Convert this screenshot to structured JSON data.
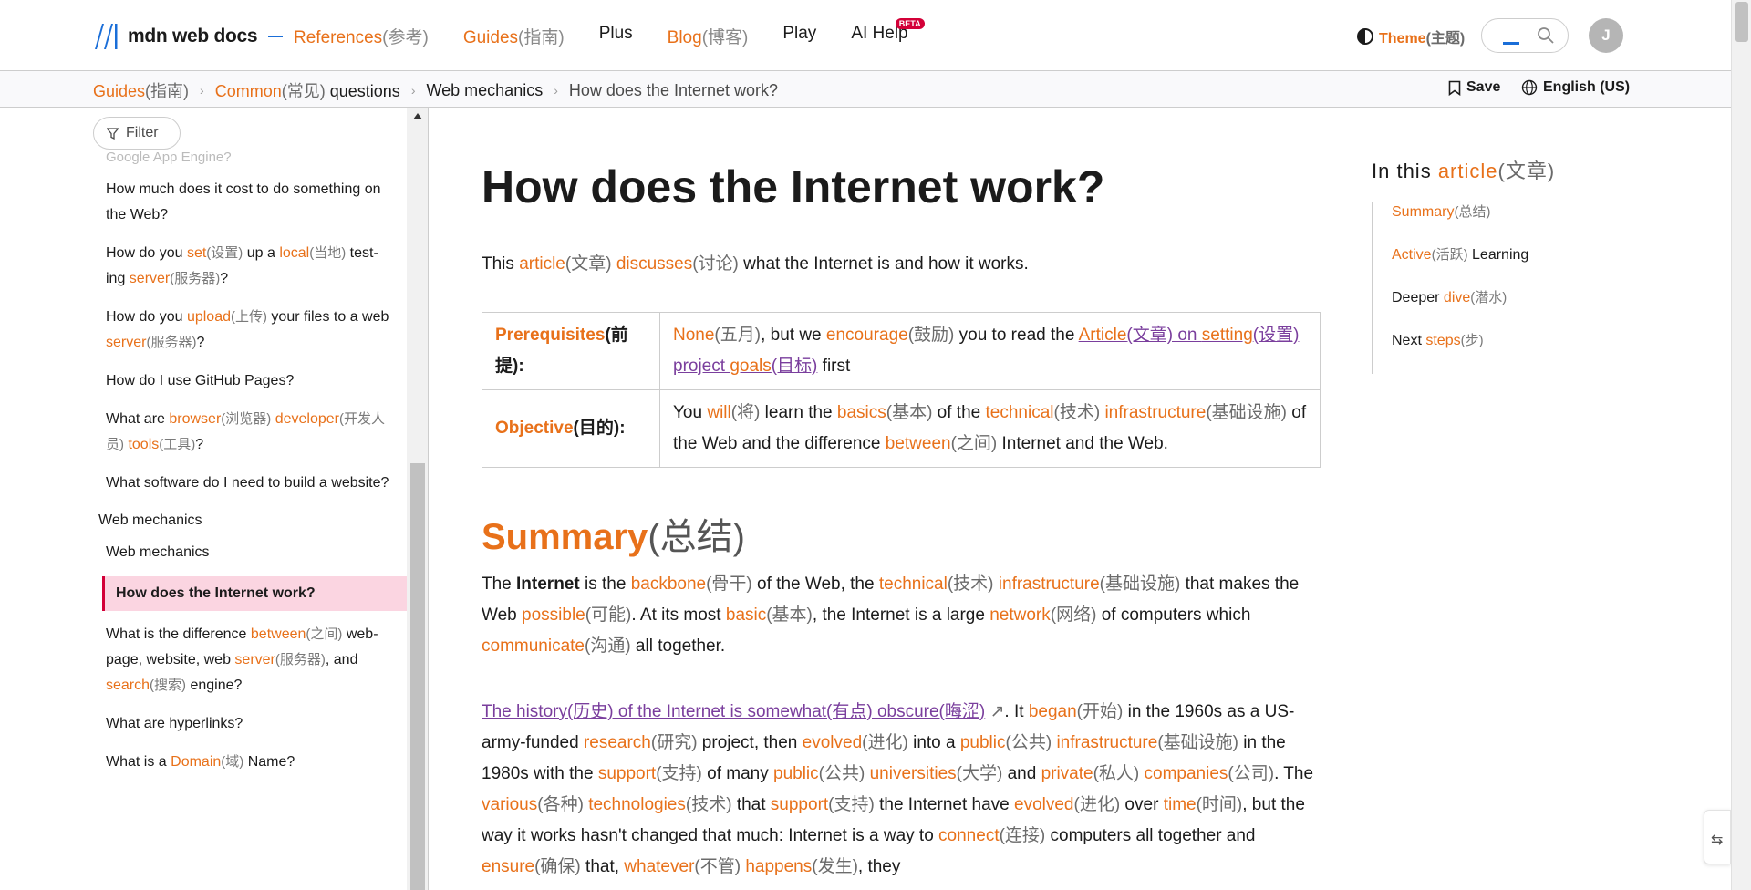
{
  "header": {
    "logo_text": "mdn web docs",
    "nav": [
      {
        "en": "References",
        "cn": "(参考)",
        "highlight": true
      },
      {
        "en": "Guides",
        "cn": "(指南)",
        "highlight": true
      },
      {
        "en": "Plus",
        "cn": "",
        "highlight": false
      },
      {
        "en": "Blog",
        "cn": "(博客)",
        "highlight": true
      },
      {
        "en": "Play",
        "cn": "",
        "highlight": false
      },
      {
        "en": "AI Help",
        "cn": "",
        "highlight": false,
        "badge": "BETA"
      }
    ],
    "theme_en": "Theme",
    "theme_cn": "(主题)",
    "avatar_letter": "J"
  },
  "breadcrumb": {
    "guides_en": "Guides",
    "guides_cn": "(指南)",
    "common_en": "Common",
    "common_cn": "(常见)",
    "common_rest": " questions",
    "web_mechanics": "Web mechanics",
    "current": "How does the Internet work?",
    "save_label": "Save",
    "language_label": "English (US)"
  },
  "sidebar": {
    "filter_label": "Filter",
    "faded_item": "Google App Engine?",
    "items_before": [
      {
        "html": "How much does it cost to do something on the Web?"
      },
      {
        "html": "How do you <span class=\"o\">set</span><span class=\"cn\">(设置)</span> up a <span class=\"o\">local</span><span class=\"cn\">(当地)</span> test-ing <span class=\"o\">server</span><span class=\"cn\">(服务器)</span>?"
      },
      {
        "html": "How do you <span class=\"o\">upload</span><span class=\"cn\">(上传)</span> your files to a web <span class=\"o\">server</span><span class=\"cn\">(服务器)</span>?"
      },
      {
        "html": "How do I use GitHub Pages?"
      },
      {
        "html": "What are <span class=\"o\">browser</span><span class=\"cn\">(浏览器)</span> <span class=\"o\">developer</span><span class=\"cn\">(开发人员)</span> <span class=\"o\">tools</span><span class=\"cn\">(工具)</span>?"
      },
      {
        "html": "What software do I need to build a website?"
      }
    ],
    "group_label": "Web mechanics",
    "group_first": "Web mechanics",
    "active_item": "How does the Internet work?",
    "items_after": [
      {
        "html": "What is the difference <span class=\"o\">between</span><span class=\"cn\">(之间)</span> web-page, website, web <span class=\"o\">server</span><span class=\"cn\">(服务器)</span>, and <span class=\"o\">search</span><span class=\"cn\">(搜索)</span> engine?"
      },
      {
        "html": "What are hyperlinks?"
      },
      {
        "html": "What is a <span class=\"o\">Domain</span><span class=\"cn\">(域)</span> Name?"
      }
    ]
  },
  "article": {
    "title": "How does the Internet work?",
    "intro_html": "This <span class=\"o\">article</span><span class=\"g\">(文章)</span> <span class=\"o\">discusses</span><span class=\"g\">(讨论)</span> what the Internet is and how it works.",
    "prereq_label_en": "Prerequisites",
    "prereq_label_cn": "(前提):",
    "prereq_html": "<span class=\"o\">None</span><span class=\"g\">(五月)</span>, but we <span class=\"o\">encourage</span><span class=\"g\">(鼓励)</span> you to read the <a class=\"lnk\" data-name=\"article-link\" data-interactable=\"true\"><span class=\"o\">Article</span>(文章) on <span class=\"o\">setting</span>(设置) project <span class=\"o\">goals</span>(目标)</a> first",
    "objective_label_en": "Objective",
    "objective_label_cn": "(目的):",
    "objective_html": "You <span class=\"o\">will</span><span class=\"g\">(将)</span> learn the <span class=\"o\">basics</span><span class=\"g\">(基本)</span> of the <span class=\"o\">technical</span><span class=\"g\">(技术)</span> <span class=\"o\">infrastructure</span><span class=\"g\">(基础设施)</span> of the Web and the difference <span class=\"o\">between</span><span class=\"g\">(之间)</span> Internet and the Web.",
    "summary_en": "Summary",
    "summary_cn": "(总结)",
    "p1_html": "The <b>Internet</b> is the <span class=\"o\">backbone</span><span class=\"g\">(骨干)</span> of the Web, the <span class=\"o\">technical</span><span class=\"g\">(技术)</span> <span class=\"o\">infrastructure</span><span class=\"g\">(基础设施)</span> that makes the Web <span class=\"o\">possible</span><span class=\"g\">(可能)</span>. At its most <span class=\"o\">basic</span><span class=\"g\">(基本)</span>, the Internet is a large <span class=\"o\">network</span><span class=\"g\">(网络)</span> of computers which <span class=\"o\">communicate</span><span class=\"g\">(沟通)</span> all together.",
    "p2_html": "<a class=\"hist\" data-name=\"history-link\" data-interactable=\"true\">The history(历史) of the Internet is somewhat(有点) obscure(晦涩)</a> <span class=\"g\">↗</span>. It <span class=\"o\">began</span><span class=\"g\">(开始)</span> in the 1960s as a US-army-funded <span class=\"o\">research</span><span class=\"g\">(研究)</span> project, then <span class=\"o\">evolved</span><span class=\"g\">(进化)</span> into a <span class=\"o\">public</span><span class=\"g\">(公共)</span> <span class=\"o\">infrastructure</span><span class=\"g\">(基础设施)</span> in the 1980s with the <span class=\"o\">support</span><span class=\"g\">(支持)</span> of many <span class=\"o\">public</span><span class=\"g\">(公共)</span> <span class=\"o\">universities</span><span class=\"g\">(大学)</span> and <span class=\"o\">private</span><span class=\"g\">(私人)</span> <span class=\"o\">companies</span><span class=\"g\">(公司)</span>. The <span class=\"o\">various</span><span class=\"g\">(各种)</span> <span class=\"o\">technologies</span><span class=\"g\">(技术)</span> that <span class=\"o\">support</span><span class=\"g\">(支持)</span> the Internet have <span class=\"o\">evolved</span><span class=\"g\">(进化)</span> over <span class=\"o\">time</span><span class=\"g\">(时间)</span>, but the way it works hasn't changed that much: Internet is a way to <span class=\"o\">connect</span><span class=\"g\">(连接)</span> computers all together and <span class=\"o\">ensure</span><span class=\"g\">(确保)</span> that, <span class=\"o\">whatever</span><span class=\"g\">(不管)</span> <span class=\"o\">happens</span><span class=\"g\">(发生)</span>, they"
  },
  "toc": {
    "title_prefix": "In this ",
    "title_en": "article",
    "title_cn": "(文章)",
    "items": [
      {
        "html": "<span class=\"o\">Summary</span><span class=\"cn\">(总结)</span>"
      },
      {
        "html": "<span class=\"o\">Active</span><span class=\"cn\">(活跃)</span> Learning"
      },
      {
        "html": "Deeper <span class=\"o\">dive</span><span class=\"cn\">(潜水)</span>"
      },
      {
        "html": "Next <span class=\"o\">steps</span><span class=\"cn\">(步)</span>"
      }
    ]
  },
  "colors": {
    "accent": "#e8711a",
    "link_visited": "#7a3e9d",
    "active_bg": "#fbd5e1",
    "active_border": "#d30038"
  },
  "icons": [
    "mdn-logo-icon",
    "theme-icon",
    "search-icon",
    "bookmark-icon",
    "globe-icon",
    "filter-icon",
    "external-link-icon"
  ]
}
